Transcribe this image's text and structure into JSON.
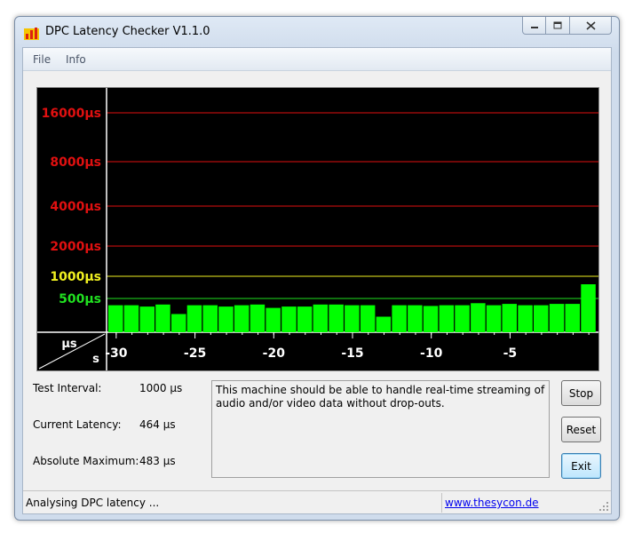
{
  "window": {
    "title": "DPC Latency Checker V1.1.0"
  },
  "menu": {
    "items": [
      "File",
      "Info"
    ]
  },
  "graph": {
    "y_labels": [
      {
        "text": "16000µs",
        "color": "#e01010"
      },
      {
        "text": "8000µs",
        "color": "#e01010"
      },
      {
        "text": "4000µs",
        "color": "#e01010"
      },
      {
        "text": "2000µs",
        "color": "#e01010"
      },
      {
        "text": "1000µs",
        "color": "#f0f020"
      },
      {
        "text": "500µs",
        "color": "#20e020"
      }
    ],
    "corner_units": {
      "y": "µs",
      "x": "s"
    },
    "x_labels": [
      "-30",
      "-25",
      "-20",
      "-15",
      "-10",
      "-5"
    ],
    "bar_color": "#00ff00",
    "bar_values_us": [
      400,
      400,
      380,
      410,
      270,
      400,
      400,
      380,
      400,
      410,
      360,
      380,
      380,
      410,
      410,
      400,
      400,
      230,
      400,
      400,
      390,
      400,
      400,
      430,
      400,
      420,
      400,
      400,
      420,
      420,
      820
    ]
  },
  "info": {
    "test_interval_label": "Test Interval:",
    "test_interval_value": "1000 µs",
    "current_latency_label": "Current Latency:",
    "current_latency_value": "464 µs",
    "absolute_max_label": "Absolute Maximum:",
    "absolute_max_value": "483 µs"
  },
  "message": "This machine should be able to handle real-time streaming of audio and/or video data without drop-outs.",
  "buttons": {
    "stop": "Stop",
    "reset": "Reset",
    "exit": "Exit"
  },
  "status": {
    "text": "Analysing DPC latency ...",
    "link": "www.thesycon.de"
  }
}
